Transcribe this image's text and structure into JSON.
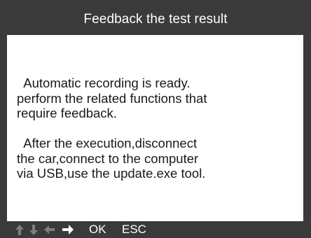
{
  "dialog": {
    "title": "Feedback the test result",
    "line1": "  Automatic recording is ready.\nperform the related functions that\nrequire feedback.",
    "line2": "  After the execution,disconnect\nthe car,connect to the computer\nvia USB,use the update.exe tool."
  },
  "footer": {
    "icons": [
      "arrow-up-icon",
      "arrow-down-icon",
      "arrow-left-icon",
      "arrow-right-icon"
    ],
    "ok_label": "OK",
    "esc_label": "ESC"
  },
  "colors": {
    "frame": "#3a3a3a",
    "background": "#ffffff",
    "text": "#1a1a1a",
    "inactive_arrow": "#7e7e7e",
    "active_arrow": "#ffffff"
  }
}
